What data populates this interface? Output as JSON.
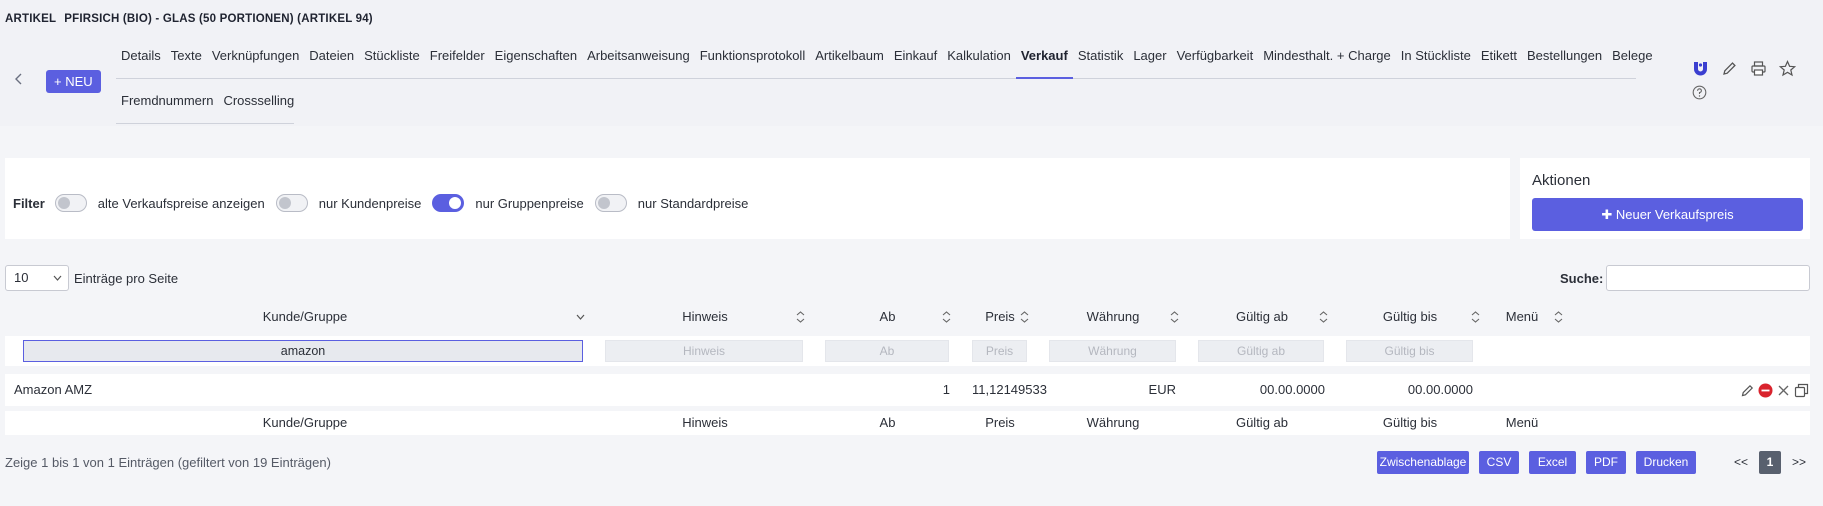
{
  "header": {
    "label": "ARTIKEL",
    "article": "PFIRSICH (BIO) - GLAS (50 PORTIONEN) (ARTIKEL 94)",
    "new_button": "+ NEU",
    "tabs_row1": [
      "Details",
      "Texte",
      "Verknüpfungen",
      "Dateien",
      "Stückliste",
      "Freifelder",
      "Eigenschaften",
      "Arbeitsanweisung",
      "Funktionsprotokoll",
      "Artikelbaum",
      "Einkauf",
      "Kalkulation",
      "Verkauf",
      "Statistik",
      "Lager",
      "Verfügbarkeit",
      "Mindesthalt. + Charge",
      "In Stückliste",
      "Etikett",
      "Bestellungen",
      "Belege"
    ],
    "tabs_row2": [
      "Fremdnummern",
      "Crossselling"
    ],
    "active_tab": "Verkauf",
    "icons": [
      "logo-icon",
      "pencil-icon",
      "printer-icon",
      "star-icon",
      "help-icon"
    ]
  },
  "filter": {
    "label": "Filter",
    "toggles": [
      {
        "label": "alte Verkaufspreise anzeigen",
        "on": false
      },
      {
        "label": "nur Kundenpreise",
        "on": false
      },
      {
        "label": "nur Gruppenpreise",
        "on": true
      },
      {
        "label": "nur Standardpreise",
        "on": false
      }
    ]
  },
  "actions": {
    "title": "Aktionen",
    "new_price": "✚ Neuer Verkaufspreis"
  },
  "table_controls": {
    "page_length": "10",
    "page_length_label": "Einträge pro Seite",
    "search_label": "Suche:",
    "search_value": ""
  },
  "table": {
    "columns": [
      "Kunde/Gruppe",
      "Hinweis",
      "Ab",
      "Preis",
      "Währung",
      "Gültig ab",
      "Gültig bis",
      "Menü"
    ],
    "filters": {
      "kunde": "amazon",
      "hinweis": "Hinweis",
      "ab": "Ab",
      "preis": "Preis",
      "waehrung": "Währung",
      "gueltig_ab": "Gültig ab",
      "gueltig_bis": "Gültig bis"
    },
    "rows": [
      {
        "kunde": "Amazon AMZ",
        "hinweis": "",
        "ab": "1",
        "preis": "11,12149533",
        "waehrung": "EUR",
        "gueltig_ab": "00.00.0000",
        "gueltig_bis": "00.00.0000"
      }
    ],
    "row_icons": [
      "pencil-icon",
      "delete-icon",
      "close-icon",
      "copy-icon"
    ]
  },
  "footer": {
    "info": "Zeige 1 bis 1 von 1 Einträgen (gefiltert von 19 Einträgen)",
    "buttons": [
      "Zwischenablage",
      "CSV",
      "Excel",
      "PDF",
      "Drucken"
    ],
    "prev": "<<",
    "page": "1",
    "next": ">>"
  },
  "colors": {
    "accent": "#5b5fe0",
    "danger": "#d9232d"
  }
}
